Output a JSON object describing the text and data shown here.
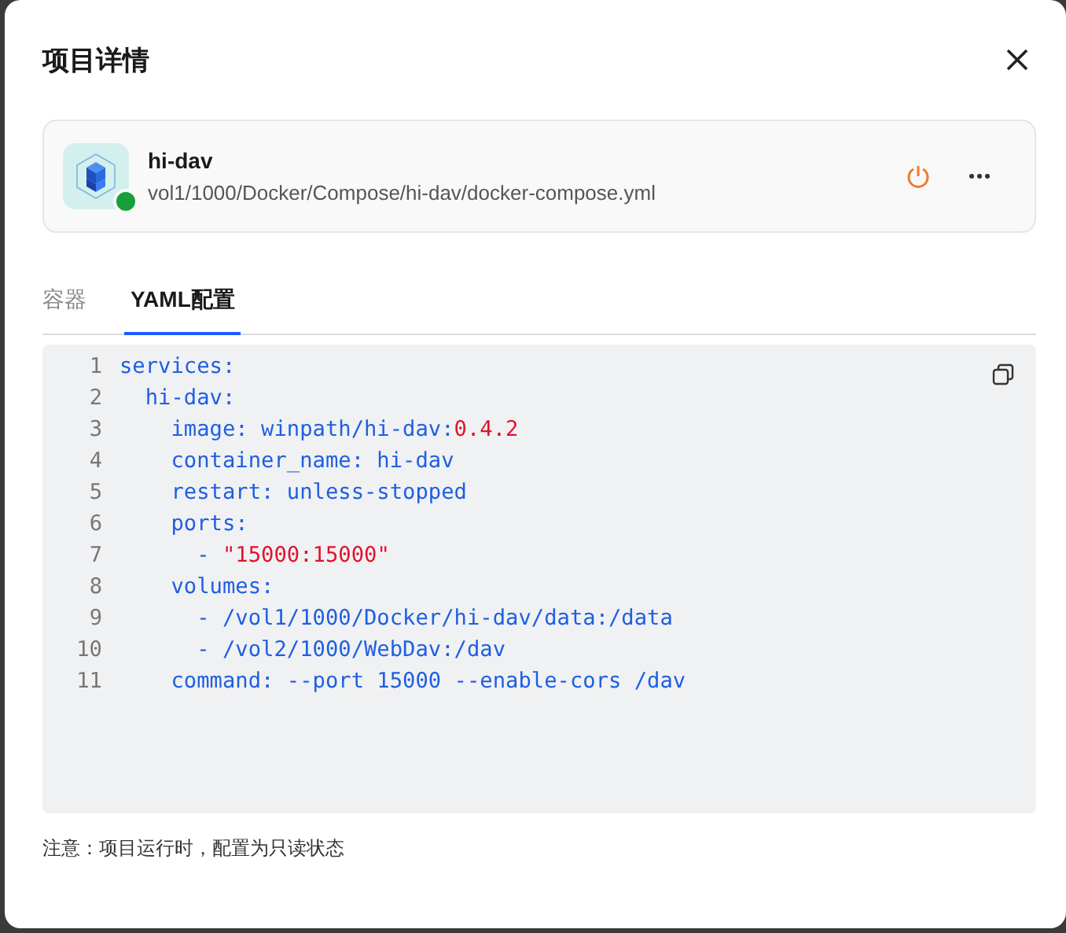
{
  "dialog": {
    "title": "项目详情"
  },
  "project": {
    "name": "hi-dav",
    "path": "vol1/1000/Docker/Compose/hi-dav/docker-compose.yml",
    "running": true
  },
  "tabs": [
    {
      "label": "容器",
      "selected": false
    },
    {
      "label": "YAML配置",
      "selected": true
    }
  ],
  "code": [
    {
      "number": "1",
      "segments": [
        {
          "text": "services:",
          "kind": "plain"
        }
      ]
    },
    {
      "number": "2",
      "segments": [
        {
          "text": "  hi-dav:",
          "kind": "plain"
        }
      ]
    },
    {
      "number": "3",
      "segments": [
        {
          "text": "    image: winpath/hi-dav:",
          "kind": "plain"
        },
        {
          "text": "0.4.2",
          "kind": "string"
        }
      ]
    },
    {
      "number": "4",
      "segments": [
        {
          "text": "    container_name: hi-dav",
          "kind": "plain"
        }
      ]
    },
    {
      "number": "5",
      "segments": [
        {
          "text": "    restart: unless-stopped",
          "kind": "plain"
        }
      ]
    },
    {
      "number": "6",
      "segments": [
        {
          "text": "    ports:",
          "kind": "plain"
        }
      ]
    },
    {
      "number": "7",
      "segments": [
        {
          "text": "      - ",
          "kind": "plain"
        },
        {
          "text": "\"15000:15000\"",
          "kind": "string"
        }
      ]
    },
    {
      "number": "8",
      "segments": [
        {
          "text": "    volumes:",
          "kind": "plain"
        }
      ]
    },
    {
      "number": "9",
      "segments": [
        {
          "text": "      - /vol1/1000/Docker/hi-dav/data:/data",
          "kind": "plain"
        }
      ]
    },
    {
      "number": "10",
      "segments": [
        {
          "text": "      - /vol2/1000/WebDav:/dav",
          "kind": "plain"
        }
      ]
    },
    {
      "number": "11",
      "segments": [
        {
          "text": "    command: --port 15000 --enable-cors /dav",
          "kind": "plain"
        }
      ]
    }
  ],
  "note": "注意：项目运行时，配置为只读状态"
}
